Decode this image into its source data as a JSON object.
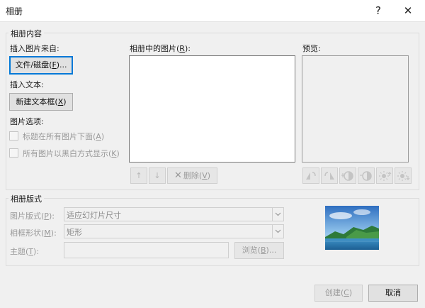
{
  "window": {
    "title": "相册",
    "help_glyph": "?",
    "close_glyph": "✕"
  },
  "album_content": {
    "group_label": "相册内容",
    "insert_from_label": "插入图片来自:",
    "file_disk_button": {
      "text": "文件/磁盘(",
      "key": "F",
      "suffix": ")..."
    },
    "insert_text_label": "插入文本:",
    "new_textbox_button": {
      "text": "新建文本框(",
      "key": "X",
      "suffix": ")"
    },
    "picture_options_label": "图片选项:",
    "option_captions": {
      "text": "标题在所有图片下面(",
      "key": "A",
      "suffix": ")",
      "checked": false
    },
    "option_bw": {
      "text": "所有图片以黑白方式显示(",
      "key": "K",
      "suffix": ")",
      "checked": false
    },
    "pictures_label": {
      "text": "相册中的图片(",
      "key": "R",
      "suffix": "):"
    },
    "up_glyph": "↑",
    "down_glyph": "↓",
    "remove_button": {
      "glyph": "✕",
      "text": "删除(",
      "key": "V",
      "suffix": ")"
    },
    "preview_label": "预览:"
  },
  "album_layout": {
    "group_label": "相册版式",
    "picture_layout": {
      "label": "图片版式(",
      "key": "P",
      "suffix": "):",
      "value": "适应幻灯片尺寸"
    },
    "frame_shape": {
      "label": "相框形状(",
      "key": "M",
      "suffix": "):",
      "value": "矩形"
    },
    "theme": {
      "label": "主题(",
      "key": "T",
      "suffix": "):",
      "value": ""
    },
    "browse_button": {
      "text": "浏览(",
      "key": "B",
      "suffix": ")..."
    }
  },
  "footer": {
    "create_button": {
      "text": "创建(",
      "key": "C",
      "suffix": ")"
    },
    "cancel_button": "取消"
  },
  "colors": {
    "accent": "#0078d7",
    "dialog_bg": "#f0f0f0",
    "disabled_text": "#9a9a9a"
  }
}
